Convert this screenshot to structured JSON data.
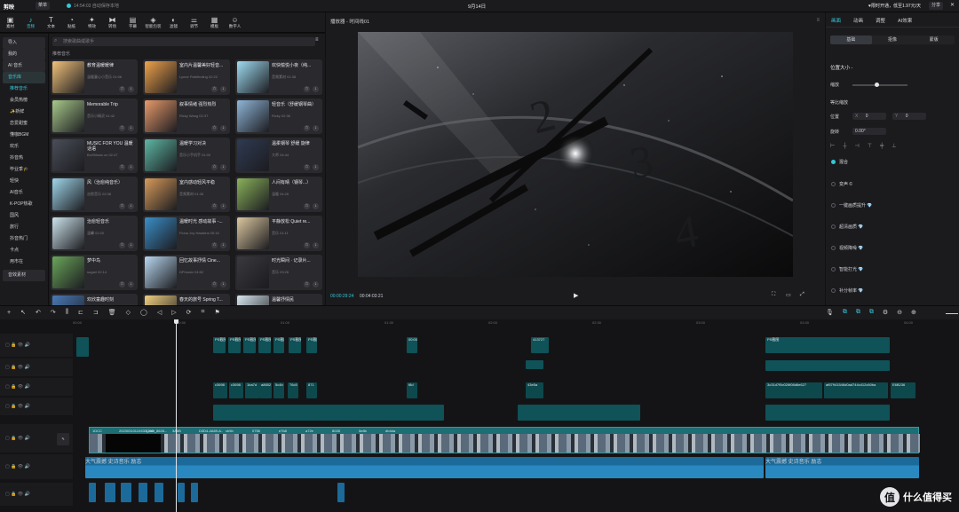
{
  "app": {
    "name": "剪映",
    "menu_label": "菜单",
    "autosave": "14:54:03 自动保存本地",
    "project_title": "9月14日",
    "promo": "♥限时开通，低至1.97元/天",
    "share_label": "分享"
  },
  "toolbar": {
    "tabs": [
      {
        "label": "素材",
        "icon": "media-icon"
      },
      {
        "label": "音频",
        "icon": "audio-icon"
      },
      {
        "label": "文本",
        "icon": "text-icon"
      },
      {
        "label": "贴纸",
        "icon": "sticker-icon"
      },
      {
        "label": "特效",
        "icon": "effects-icon"
      },
      {
        "label": "转场",
        "icon": "transition-icon"
      },
      {
        "label": "字幕",
        "icon": "subtitle-icon"
      },
      {
        "label": "智能包装",
        "icon": "smart-package-icon"
      },
      {
        "label": "滤镜",
        "icon": "filter-icon"
      },
      {
        "label": "调节",
        "icon": "adjust-icon"
      },
      {
        "label": "模板",
        "icon": "template-icon"
      },
      {
        "label": "数字人",
        "icon": "digital-human-icon"
      }
    ],
    "active_index": 1
  },
  "sidebar": {
    "items": [
      {
        "label": "导入",
        "style": "btn"
      },
      {
        "label": "我的",
        "style": "btn"
      },
      {
        "label": "AI 音乐",
        "style": "btn"
      },
      {
        "label": "音乐库",
        "style": "active"
      },
      {
        "label": "推荐音乐",
        "style": "hl"
      },
      {
        "label": "会员热榜",
        "style": "sub"
      },
      {
        "label": "✨新鲜",
        "style": "sub"
      },
      {
        "label": "恋爱甜蜜",
        "style": "sub"
      },
      {
        "label": "懂咖BGM",
        "style": "sub"
      },
      {
        "label": "欢乐",
        "style": "sub"
      },
      {
        "label": "抖音热",
        "style": "sub"
      },
      {
        "label": "毕业季🎓",
        "style": "sub"
      },
      {
        "label": "轻快",
        "style": "sub"
      },
      {
        "label": "AI音乐",
        "style": "sub"
      },
      {
        "label": "K-POP热歌",
        "style": "sub"
      },
      {
        "label": "国风",
        "style": "sub"
      },
      {
        "label": "旅行",
        "style": "sub"
      },
      {
        "label": "抖音热门",
        "style": "sub"
      },
      {
        "label": "卡点",
        "style": "sub"
      },
      {
        "label": "用市在",
        "style": "sub"
      },
      {
        "label": "音效素材",
        "style": "btn"
      }
    ]
  },
  "media": {
    "search_placeholder": "搜索歌曲或歌手",
    "section_title": "推荐音乐",
    "cards": [
      {
        "title": "教育温暖暖律",
        "sub": "温暖童心小音乐 01:06",
        "color": "#f2c27a"
      },
      {
        "title": "室内片温馨美好轻音...",
        "sub": "Lynne Pathfinding 02:22",
        "color": "#f0a24a"
      },
      {
        "title": "欢快愉悦小夜（纯...",
        "sub": "音频素材 01:38",
        "color": "#9fdcf2"
      },
      {
        "title": "Memorable Trip",
        "sub": "音乐小精灵 01:42",
        "color": "#a8c98a"
      },
      {
        "title": "叙事情绪 强烈热烈",
        "sub": "Ricky Wang 02:37",
        "color": "#e89a6a"
      },
      {
        "title": "轻音乐（舒缓钢琴曲）",
        "sub": "Ricky 02:36",
        "color": "#8fb6d8"
      },
      {
        "title": "MUSIC FOR YOU 温暖话语",
        "sub": "BoXMusic.cn 02:47",
        "color": "#4a4e58"
      },
      {
        "title": "温暖学习对决",
        "sub": "音乐小手机手 01:00",
        "color": "#5db8a4"
      },
      {
        "title": "温柔钢琴 舒缓 旋律",
        "sub": "大师 04:44",
        "color": "#2e3b52"
      },
      {
        "title": "风（治愈纯音乐）",
        "sub": "治愈音乐 02:38",
        "color": "#9fd6ea"
      },
      {
        "title": "室内感动轻风平稳",
        "sub": "音频素材 01:35",
        "color": "#d79a5a"
      },
      {
        "title": "人间有晴（钢琴...）",
        "sub": "温暖 04:26",
        "color": "#8ab25a"
      },
      {
        "title": "治愈轻音乐",
        "sub": "温馨 02:20",
        "color": "#cde4ec"
      },
      {
        "title": "温暖时光 感动故事 -...",
        "sub": "Fiona Joy Hawkins 05:16",
        "color": "#3a8ec8"
      },
      {
        "title": "平静放松 Quiet re...",
        "sub": "音乐 01:11",
        "color": "#dcc8a0"
      },
      {
        "title": "梦中鸟",
        "sub": "sugari 02:14",
        "color": "#6aa65a"
      },
      {
        "title": "回忆故事抒情 Cine...",
        "sub": "DPmusic 04:52",
        "color": "#b8d8f0"
      },
      {
        "title": "时光瞬间 · 记录片...",
        "sub": "音乐 03:26",
        "color": "#3a3a3e"
      },
      {
        "title": "欢欣童趣时刻",
        "sub": "音频",
        "color": "#4a7ab8"
      },
      {
        "title": "春天的旅号 Spring T...",
        "sub": "音乐",
        "color": "#f0d080"
      },
      {
        "title": "温馨抒情民",
        "sub": "音乐",
        "color": "#d8e8f0"
      }
    ]
  },
  "player": {
    "title": "播放器 - 时间线01",
    "current_time": "00:00:29:24",
    "total_time": "00:04:03:21",
    "clock_numbers": [
      "2",
      "3",
      "4"
    ]
  },
  "props": {
    "tabs": [
      "画面",
      "动画",
      "调整",
      "AI效果"
    ],
    "subtabs": [
      "基础",
      "抠像",
      "蒙版"
    ],
    "section_position": "位置大小 -",
    "scale_label": "缩放",
    "uniform_scale_label": "等比缩放",
    "position_label": "位置",
    "position_x": "0",
    "position_y": "0",
    "rotate_label": "旋转",
    "rotate_value": "0.00°",
    "blend_label": "混合",
    "options": [
      "变声 ©",
      "一键画质提升 💎",
      "超清画质 💎",
      "视频降噪 💎",
      "智能打光 💎",
      "补分帧率 💎"
    ]
  },
  "timeline": {
    "ruler_marks": [
      "00:00",
      "00:30",
      "01:00",
      "01:30",
      "02:00",
      "02:30",
      "03:00",
      "03:30",
      "04:00"
    ],
    "main_clip_labels": [
      "1DCC",
      "20230310124531_edit_8626...",
      "5250",
      "3A6B",
      "D3D4-4A69-A..",
      "cb5b",
      "0756",
      "e7b8",
      "a72e",
      "8028",
      "5e8b",
      "db4da"
    ],
    "audio_labels": [
      "大气震撼 史诗音乐 励志",
      "大气震撼 史诗音乐 励志"
    ],
    "sticker_labels": [
      "PS截图",
      "PS截图",
      "PS截图",
      "PS截图",
      "PS截图",
      "PS截图",
      "PS截图2.png",
      "00:00:19:14",
      "413727",
      "PS截图"
    ],
    "text_labels": [
      "c3698",
      "c3698",
      "1ba7d",
      "a8652",
      "5c4b",
      "76c5",
      "871",
      "f8d",
      "43e5a",
      "3c31d7f5c026f08d6e627",
      "af67941546d0ad744c412c60ba",
      "E6B236"
    ]
  }
}
